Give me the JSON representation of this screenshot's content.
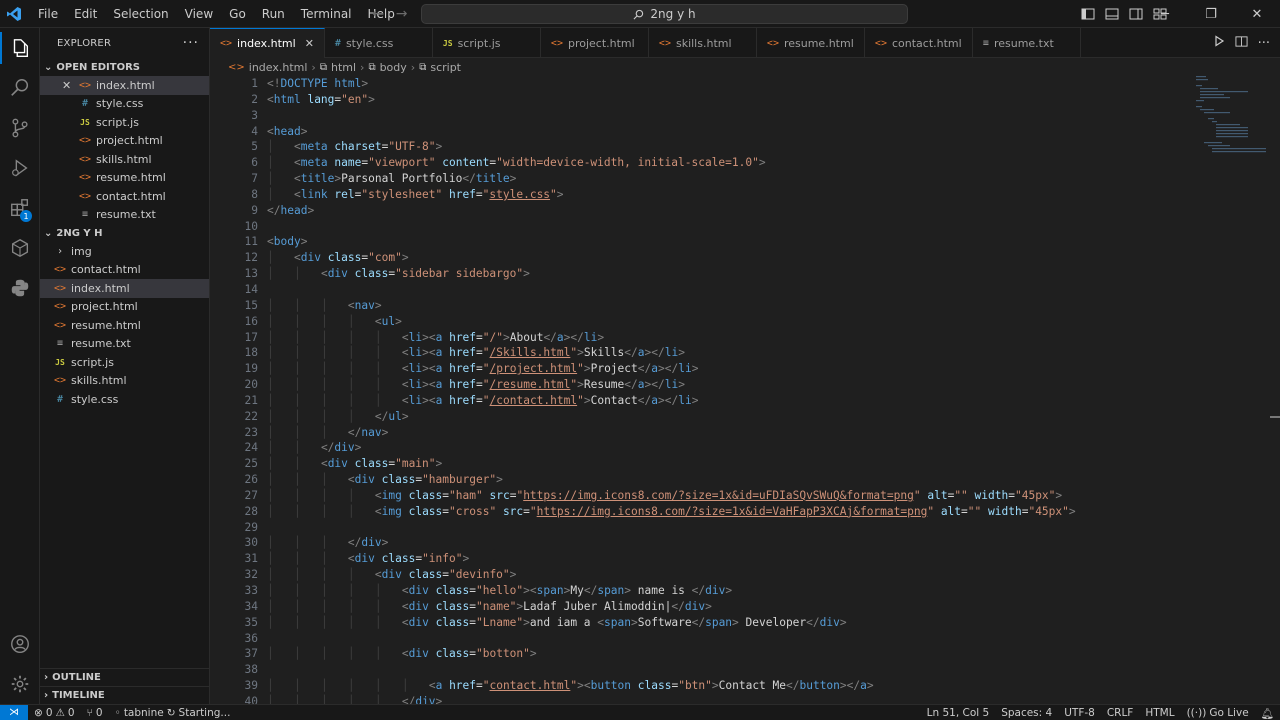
{
  "menu": [
    "File",
    "Edit",
    "Selection",
    "View",
    "Go",
    "Run",
    "Terminal",
    "Help"
  ],
  "search": {
    "text": "2ng y h"
  },
  "sidebar": {
    "title": "EXPLORER",
    "open_editors_label": "OPEN EDITORS",
    "open_editors": [
      {
        "name": "index.html",
        "type": "html"
      },
      {
        "name": "style.css",
        "type": "css"
      },
      {
        "name": "script.js",
        "type": "js"
      },
      {
        "name": "project.html",
        "type": "html"
      },
      {
        "name": "skills.html",
        "type": "html"
      },
      {
        "name": "resume.html",
        "type": "html"
      },
      {
        "name": "contact.html",
        "type": "html"
      },
      {
        "name": "resume.txt",
        "type": "txt"
      }
    ],
    "folder_label": "2NG Y H",
    "folder_items": [
      {
        "name": "img",
        "type": "folder"
      },
      {
        "name": "contact.html",
        "type": "html"
      },
      {
        "name": "index.html",
        "type": "html"
      },
      {
        "name": "project.html",
        "type": "html"
      },
      {
        "name": "resume.html",
        "type": "html"
      },
      {
        "name": "resume.txt",
        "type": "txt"
      },
      {
        "name": "script.js",
        "type": "js"
      },
      {
        "name": "skills.html",
        "type": "html"
      },
      {
        "name": "style.css",
        "type": "css"
      }
    ],
    "outline_label": "OUTLINE",
    "timeline_label": "TIMELINE"
  },
  "activity_badge": "1",
  "tabs": [
    {
      "name": "index.html",
      "type": "html",
      "active": true
    },
    {
      "name": "style.css",
      "type": "css"
    },
    {
      "name": "script.js",
      "type": "js"
    },
    {
      "name": "project.html",
      "type": "html"
    },
    {
      "name": "skills.html",
      "type": "html"
    },
    {
      "name": "resume.html",
      "type": "html"
    },
    {
      "name": "contact.html",
      "type": "html"
    },
    {
      "name": "resume.txt",
      "type": "txt"
    }
  ],
  "breadcrumb": [
    "index.html",
    "html",
    "body",
    "script"
  ],
  "code_lines": [
    "<!DOCTYPE html>",
    "<html lang=\"en\">",
    "",
    "<head>",
    "    <meta charset=\"UTF-8\">",
    "    <meta name=\"viewport\" content=\"width=device-width, initial-scale=1.0\">",
    "    <title>Parsonal Portfolio</title>",
    "    <link rel=\"stylesheet\" href=\"style.css\">",
    "</head>",
    "",
    "<body>",
    "    <div class=\"com\">",
    "        <div class=\"sidebar sidebargo\">",
    "",
    "            <nav>",
    "                <ul>",
    "                    <li><a href=\"/\">About</a></li>",
    "                    <li><a href=\"/Skills.html\">Skills</a></li>",
    "                    <li><a href=\"/project.html\">Project</a></li>",
    "                    <li><a href=\"/resume.html\">Resume</a></li>",
    "                    <li><a href=\"/contact.html\">Contact</a></li>",
    "                </ul>",
    "            </nav>",
    "        </div>",
    "        <div class=\"main\">",
    "            <div class=\"hamburger\">",
    "                <img class=\"ham\" src=\"https://img.icons8.com/?size=1x&id=uFDIaSQvSWuQ&format=png\" alt=\"\" width=\"45px\">",
    "                <img class=\"cross\" src=\"https://img.icons8.com/?size=1x&id=VaHFapP3XCAj&format=png\" alt=\"\" width=\"45px\">",
    "",
    "            </div>",
    "            <div class=\"info\">",
    "                <div class=\"devinfo\">",
    "                    <div class=\"hello\"><span>My</span> name is </div>",
    "                    <div class=\"name\">Ladaf Juber Alimoddin|</div>",
    "                    <div class=\"Lname\">and iam a <span>Software</span> Developer</div>",
    "",
    "                    <div class=\"botton\">",
    "",
    "                        <a href=\"contact.html\"><button class=\"btn\">Contact Me</button></a>",
    "                    </div>"
  ],
  "status": {
    "errors": "0",
    "warnings": "0",
    "ports": "0",
    "tabnine": "tabnine",
    "starting": "Starting...",
    "position": "Ln 51, Col 5",
    "spaces": "Spaces: 4",
    "encoding": "UTF-8",
    "eol": "CRLF",
    "language": "HTML",
    "golive": "Go Live"
  }
}
